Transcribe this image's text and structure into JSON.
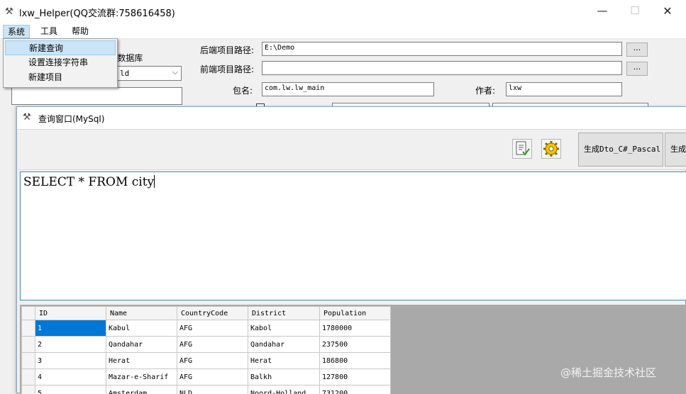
{
  "window": {
    "title": "lxw_Helper(QQ交流群:758616458)",
    "minimize_label": "—",
    "maximize_label": "☐",
    "close_label": "✕"
  },
  "menu": {
    "system": "系统",
    "tools": "工具",
    "help": "帮助"
  },
  "dropdown": {
    "new_query": "新建查询",
    "set_connection": "设置连接字符串",
    "new_project": "新建项目"
  },
  "form": {
    "db_label_partial": "l数据库",
    "db_value_partial": "ld",
    "backend_path_label": "后端项目路径:",
    "backend_path_value": "E:\\Demo",
    "frontend_path_label": "前端项目路径:",
    "frontend_path_value": "",
    "package_label": "包名:",
    "package_value": "com.lw.lw_main",
    "author_label": "作者:",
    "author_value": "lxw",
    "browse_label": "..."
  },
  "query_window": {
    "title": "查询窗口(MySql)",
    "gen_dto_label": "生成Dto_C#_Pascal",
    "gen_other_label": "生成",
    "sql_text": "SELECT * FROM city"
  },
  "grid": {
    "columns": [
      "ID",
      "Name",
      "CountryCode",
      "District",
      "Population"
    ],
    "rows": [
      [
        "1",
        "Kabul",
        "AFG",
        "Kabol",
        "1780000"
      ],
      [
        "2",
        "Qandahar",
        "AFG",
        "Qandahar",
        "237500"
      ],
      [
        "3",
        "Herat",
        "AFG",
        "Herat",
        "186800"
      ],
      [
        "4",
        "Mazar-e-Sharif",
        "AFG",
        "Balkh",
        "127800"
      ],
      [
        "5",
        "Amsterdam",
        "NLD",
        "Noord-Holland",
        "731200"
      ]
    ]
  },
  "watermark": "@稀土掘金技术社区"
}
